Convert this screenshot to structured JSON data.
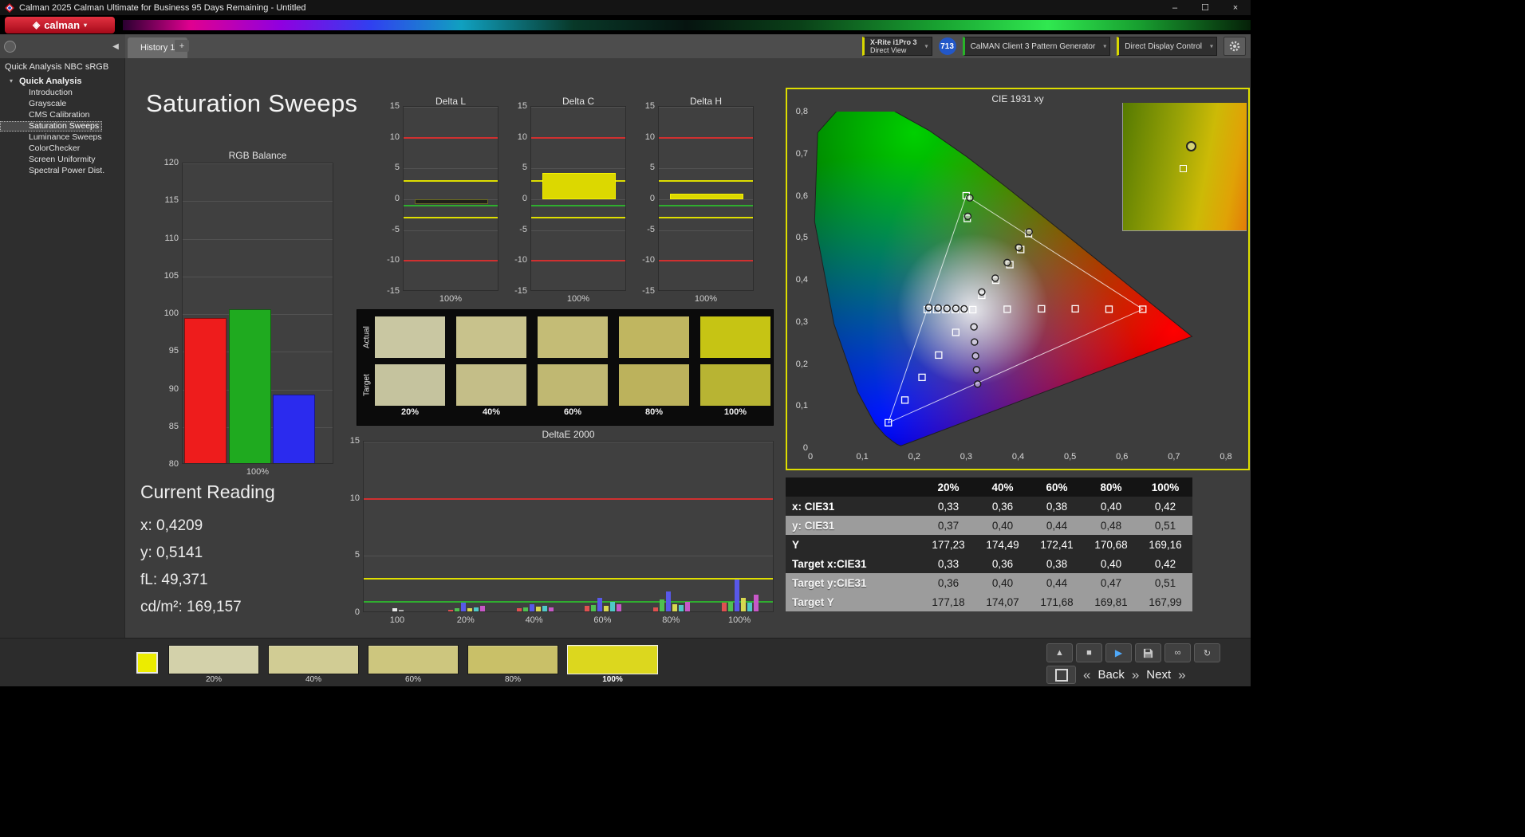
{
  "window": {
    "title": "Calman 2025 Calman Ultimate for Business 95 Days Remaining  - Untitled",
    "minimize": "–",
    "maximize": "☐",
    "close": "×"
  },
  "brand": {
    "name": "calman",
    "mark": "◈",
    "caret": "▾"
  },
  "tabs": {
    "active": "History 1",
    "add_label": "+"
  },
  "devices": {
    "meter_line1": "X-Rite i1Pro 3",
    "meter_line2": "Direct View",
    "meter_accent": "#d8d800",
    "badge": "713",
    "source_label": "CalMAN Client 3 Pattern Generator",
    "source_accent": "#28b428",
    "display_label": "Direct Display Control",
    "display_accent": "#d8d800"
  },
  "icons": {
    "collapse_left": "◀",
    "caret_down": "▾",
    "panel_up": "▲",
    "stop": "■",
    "play": "▶",
    "link": "∞",
    "refresh": "↻",
    "prev": "«",
    "next": "»"
  },
  "sidebar": {
    "header": "Quick Analysis NBC sRGB",
    "root": "Quick Analysis",
    "items": [
      {
        "label": "Introduction"
      },
      {
        "label": "Grayscale"
      },
      {
        "label": "CMS Calibration"
      },
      {
        "label": "Saturation Sweeps",
        "selected": true
      },
      {
        "label": "Luminance Sweeps"
      },
      {
        "label": "ColorChecker"
      },
      {
        "label": "Screen Uniformity"
      },
      {
        "label": "Spectral Power Dist."
      }
    ]
  },
  "page": {
    "title": "Saturation Sweeps"
  },
  "current_reading": {
    "title": "Current Reading",
    "lines": [
      {
        "label": "x:",
        "value": "0,4209"
      },
      {
        "label": "y:",
        "value": "0,5141"
      },
      {
        "label": "fL:",
        "value": "49,371"
      },
      {
        "label": "cd/m²:",
        "value": "169,157"
      }
    ]
  },
  "swatches": {
    "columns": [
      "20%",
      "40%",
      "60%",
      "80%",
      "100%"
    ],
    "rows": [
      {
        "label": "Actual",
        "colors": [
          "#c9c7a2",
          "#c8c28c",
          "#c4bc76",
          "#c0b660",
          "#c6c414"
        ]
      },
      {
        "label": "Target",
        "colors": [
          "#c5c39e",
          "#c4be88",
          "#c0b872",
          "#bcb25c",
          "#b8b433"
        ]
      }
    ]
  },
  "patterns": {
    "current_color": "#ecec00",
    "selected": "100%",
    "buttons": [
      {
        "label": "20%",
        "color": "#d3d1aa"
      },
      {
        "label": "40%",
        "color": "#d1cc94"
      },
      {
        "label": "60%",
        "color": "#cdc67e"
      },
      {
        "label": "80%",
        "color": "#c9c068"
      },
      {
        "label": "100%",
        "color": "#dcd71e"
      }
    ]
  },
  "transport": {
    "back": "Back",
    "next": "Next"
  },
  "chart_data": [
    {
      "id": "rgb_balance",
      "type": "bar",
      "title": "RGB Balance",
      "categories": [
        "Red",
        "Green",
        "Blue"
      ],
      "values": [
        99.5,
        100.6,
        89.3
      ],
      "colors": [
        "#ee1c1c",
        "#1faa1f",
        "#2b2bee"
      ],
      "ylim": [
        80,
        120
      ],
      "ystep": 5,
      "xlabel": "100%"
    },
    {
      "id": "delta_l",
      "type": "bar",
      "title": "Delta L",
      "ylim": [
        -15,
        15
      ],
      "ystep": 5,
      "xlabel": "100%",
      "bars": [
        {
          "value": -0.8,
          "color": "#20201a",
          "edge": "#6a6a20"
        }
      ],
      "reflines": [
        {
          "y": 10,
          "color": "#d03030"
        },
        {
          "y": -10,
          "color": "#d03030"
        },
        {
          "y": 3,
          "color": "#dede00"
        },
        {
          "y": -3,
          "color": "#dede00"
        },
        {
          "y": -1,
          "color": "#2fae2f"
        }
      ]
    },
    {
      "id": "delta_c",
      "type": "bar",
      "title": "Delta C",
      "ylim": [
        -15,
        15
      ],
      "ystep": 5,
      "xlabel": "100%",
      "bars": [
        {
          "value": 4.3,
          "color": "#dcd800",
          "edge": "#f6f200"
        }
      ],
      "reflines": [
        {
          "y": 10,
          "color": "#d03030"
        },
        {
          "y": -10,
          "color": "#d03030"
        },
        {
          "y": 3,
          "color": "#dede00"
        },
        {
          "y": -3,
          "color": "#dede00"
        },
        {
          "y": -1,
          "color": "#2fae2f"
        }
      ]
    },
    {
      "id": "delta_h",
      "type": "bar",
      "title": "Delta H",
      "ylim": [
        -15,
        15
      ],
      "ystep": 5,
      "xlabel": "100%",
      "bars": [
        {
          "value": 0.9,
          "color": "#dcd800",
          "edge": "#f6f200"
        }
      ],
      "reflines": [
        {
          "y": 10,
          "color": "#d03030"
        },
        {
          "y": -10,
          "color": "#d03030"
        },
        {
          "y": 3,
          "color": "#dede00"
        },
        {
          "y": -3,
          "color": "#dede00"
        },
        {
          "y": -1,
          "color": "#2fae2f"
        }
      ]
    },
    {
      "id": "deltae2000",
      "type": "grouped-bar",
      "title": "DeltaE 2000",
      "ylim": [
        0,
        15
      ],
      "ystep": 5,
      "reflines": [
        {
          "y": 10,
          "color": "#d03030"
        },
        {
          "y": 3,
          "color": "#dede00"
        },
        {
          "y": 1,
          "color": "#2fae2f"
        }
      ],
      "groups": [
        {
          "label": "100",
          "bars": [
            {
              "color": "#e8e8e8",
              "value": 0.4
            },
            {
              "color": "#b0b0b0",
              "value": 0.3
            }
          ]
        },
        {
          "label": "20%",
          "bars": [
            {
              "color": "#e05050",
              "value": 0.3
            },
            {
              "color": "#50c050",
              "value": 0.4
            },
            {
              "color": "#5858e8",
              "value": 0.9
            },
            {
              "color": "#d8d850",
              "value": 0.4
            },
            {
              "color": "#50c8c8",
              "value": 0.5
            },
            {
              "color": "#c858c8",
              "value": 0.6
            }
          ]
        },
        {
          "label": "40%",
          "bars": [
            {
              "color": "#e05050",
              "value": 0.45
            },
            {
              "color": "#50c050",
              "value": 0.5
            },
            {
              "color": "#5858e8",
              "value": 0.8
            },
            {
              "color": "#d8d850",
              "value": 0.55
            },
            {
              "color": "#50c8c8",
              "value": 0.6
            },
            {
              "color": "#c858c8",
              "value": 0.5
            }
          ]
        },
        {
          "label": "60%",
          "bars": [
            {
              "color": "#e05050",
              "value": 0.6
            },
            {
              "color": "#50c050",
              "value": 0.7
            },
            {
              "color": "#5858e8",
              "value": 1.3
            },
            {
              "color": "#d8d850",
              "value": 0.6
            },
            {
              "color": "#50c8c8",
              "value": 1.0
            },
            {
              "color": "#c858c8",
              "value": 0.8
            }
          ]
        },
        {
          "label": "80%",
          "bars": [
            {
              "color": "#e05050",
              "value": 0.5
            },
            {
              "color": "#50c050",
              "value": 1.2
            },
            {
              "color": "#5858e8",
              "value": 1.9
            },
            {
              "color": "#d8d850",
              "value": 0.8
            },
            {
              "color": "#50c8c8",
              "value": 0.7
            },
            {
              "color": "#c858c8",
              "value": 1.0
            }
          ]
        },
        {
          "label": "100%",
          "bars": [
            {
              "color": "#e05050",
              "value": 0.9
            },
            {
              "color": "#50c050",
              "value": 1.0
            },
            {
              "color": "#5858e8",
              "value": 2.9
            },
            {
              "color": "#d8d850",
              "value": 1.3
            },
            {
              "color": "#50c8c8",
              "value": 0.9
            },
            {
              "color": "#c858c8",
              "value": 1.6
            }
          ]
        }
      ]
    },
    {
      "id": "cie",
      "type": "scatter",
      "title": "CIE 1931 xy",
      "xlim": [
        0,
        0.8
      ],
      "ylim": [
        0,
        0.8
      ],
      "xticks": [
        "0",
        "0,1",
        "0,2",
        "0,3",
        "0,4",
        "0,5",
        "0,6",
        "0,7",
        "0,8"
      ],
      "yticks": [
        "0",
        "0,1",
        "0,2",
        "0,3",
        "0,4",
        "0,5",
        "0,6",
        "0,7",
        "0,8"
      ],
      "gamut_triangle": [
        [
          0.64,
          0.33
        ],
        [
          0.3,
          0.6
        ],
        [
          0.15,
          0.06
        ]
      ],
      "white_point": [
        0.3127,
        0.329
      ],
      "target_squares": [
        [
          0.3127,
          0.329
        ],
        [
          0.379,
          0.33
        ],
        [
          0.445,
          0.331
        ],
        [
          0.51,
          0.331
        ],
        [
          0.575,
          0.33
        ],
        [
          0.64,
          0.33
        ],
        [
          0.296,
          0.329
        ],
        [
          0.279,
          0.329
        ],
        [
          0.261,
          0.329
        ],
        [
          0.243,
          0.329
        ],
        [
          0.225,
          0.329
        ],
        [
          0.28,
          0.275
        ],
        [
          0.247,
          0.221
        ],
        [
          0.215,
          0.168
        ],
        [
          0.182,
          0.114
        ],
        [
          0.15,
          0.06
        ],
        [
          0.33,
          0.363
        ],
        [
          0.357,
          0.399
        ],
        [
          0.384,
          0.436
        ],
        [
          0.405,
          0.472
        ],
        [
          0.42,
          0.51
        ],
        [
          0.302,
          0.546
        ],
        [
          0.3,
          0.6
        ]
      ],
      "measured_circles": [
        [
          0.33,
          0.371
        ],
        [
          0.356,
          0.404
        ],
        [
          0.379,
          0.441
        ],
        [
          0.401,
          0.477
        ],
        [
          0.421,
          0.514
        ],
        [
          0.307,
          0.595
        ],
        [
          0.303,
          0.551
        ],
        [
          0.315,
          0.288
        ],
        [
          0.316,
          0.252
        ],
        [
          0.318,
          0.219
        ],
        [
          0.32,
          0.186
        ],
        [
          0.322,
          0.152
        ],
        [
          0.296,
          0.331
        ],
        [
          0.28,
          0.332
        ],
        [
          0.263,
          0.332
        ],
        [
          0.246,
          0.333
        ],
        [
          0.228,
          0.334
        ]
      ]
    },
    {
      "id": "results",
      "type": "table",
      "headers": [
        "",
        "20%",
        "40%",
        "60%",
        "80%",
        "100%"
      ],
      "rows": [
        {
          "label": "x: CIE31",
          "values": [
            "0,33",
            "0,36",
            "0,38",
            "0,40",
            "0,42"
          ]
        },
        {
          "label": "y: CIE31",
          "values": [
            "0,37",
            "0,40",
            "0,44",
            "0,48",
            "0,51"
          ]
        },
        {
          "label": "Y",
          "values": [
            "177,23",
            "174,49",
            "172,41",
            "170,68",
            "169,16"
          ]
        },
        {
          "label": "Target x:CIE31",
          "values": [
            "0,33",
            "0,36",
            "0,38",
            "0,40",
            "0,42"
          ]
        },
        {
          "label": "Target y:CIE31",
          "values": [
            "0,36",
            "0,40",
            "0,44",
            "0,47",
            "0,51"
          ]
        },
        {
          "label": "Target Y",
          "values": [
            "177,18",
            "174,07",
            "171,68",
            "169,81",
            "167,99"
          ]
        }
      ]
    }
  ]
}
